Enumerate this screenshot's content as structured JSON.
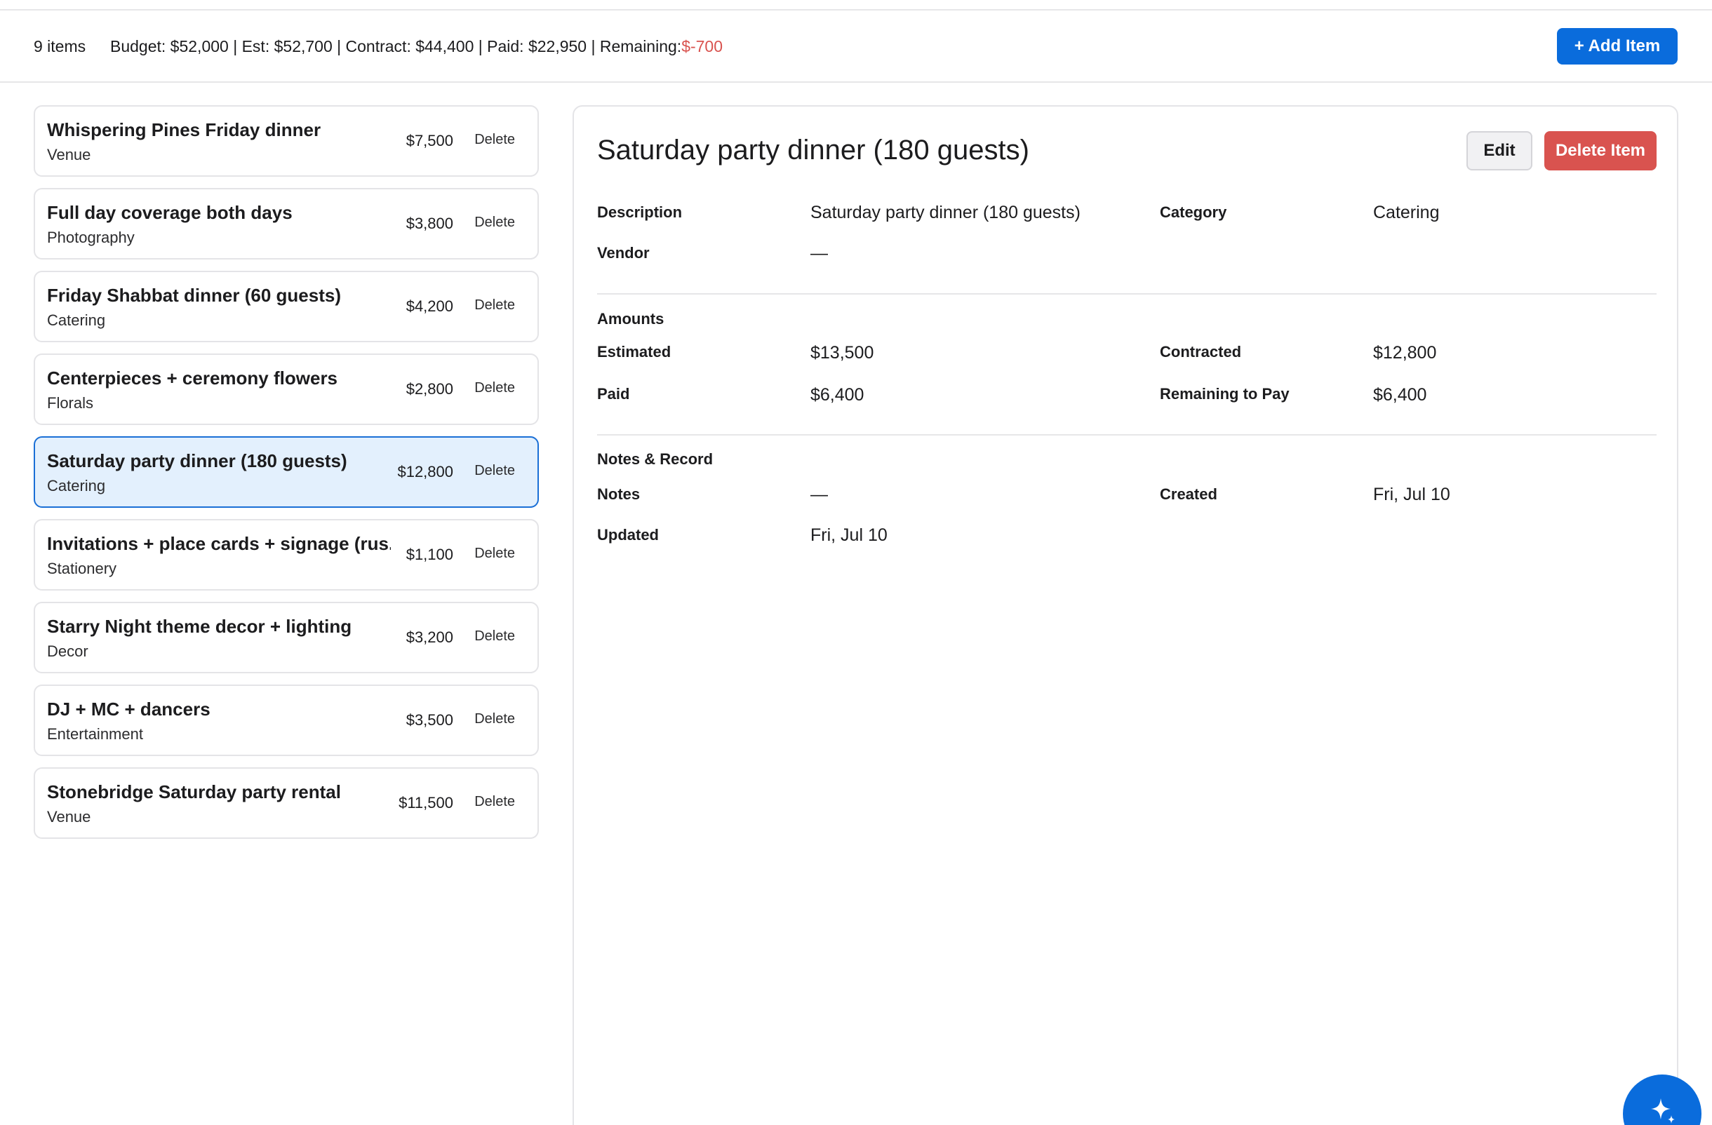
{
  "header": {
    "item_count": "9 items",
    "budget": "Budget: $52,000",
    "est": "Est: $52,700",
    "contract": "Contract: $44,400",
    "paid": "Paid: $22,950",
    "remaining_label": "Remaining:",
    "remaining_value": "$-700",
    "separator": "|",
    "add_button": "+ Add Item"
  },
  "items": [
    {
      "title": "Whispering Pines Friday dinner",
      "category": "Venue",
      "amount": "$7,500",
      "delete": "Delete"
    },
    {
      "title": "Full day coverage both days",
      "category": "Photography",
      "amount": "$3,800",
      "delete": "Delete"
    },
    {
      "title": "Friday Shabbat dinner (60 guests)",
      "category": "Catering",
      "amount": "$4,200",
      "delete": "Delete"
    },
    {
      "title": "Centerpieces + ceremony flowers",
      "category": "Florals",
      "amount": "$2,800",
      "delete": "Delete"
    },
    {
      "title": "Saturday party dinner (180 guests)",
      "category": "Catering",
      "amount": "$12,800",
      "delete": "Delete"
    },
    {
      "title": "Invitations + place cards + signage (rus...",
      "category": "Stationery",
      "amount": "$1,100",
      "delete": "Delete"
    },
    {
      "title": "Starry Night theme decor + lighting",
      "category": "Decor",
      "amount": "$3,200",
      "delete": "Delete"
    },
    {
      "title": "DJ + MC + dancers",
      "category": "Entertainment",
      "amount": "$3,500",
      "delete": "Delete"
    },
    {
      "title": "Stonebridge Saturday party rental",
      "category": "Venue",
      "amount": "$11,500",
      "delete": "Delete"
    }
  ],
  "selected_index": 4,
  "detail": {
    "title": "Saturday party dinner (180 guests)",
    "edit_button": "Edit",
    "delete_button": "Delete Item",
    "description_label": "Description",
    "description_value": "Saturday party dinner (180 guests)",
    "category_label": "Category",
    "category_value": "Catering",
    "vendor_label": "Vendor",
    "vendor_value": "—",
    "amounts_heading": "Amounts",
    "estimated_label": "Estimated",
    "estimated_value": "$13,500",
    "contracted_label": "Contracted",
    "contracted_value": "$12,800",
    "paid_label": "Paid",
    "paid_value": "$6,400",
    "remaining_label": "Remaining to Pay",
    "remaining_value": "$6,400",
    "notes_heading": "Notes & Record",
    "notes_label": "Notes",
    "notes_value": "—",
    "created_label": "Created",
    "created_value": "Fri, Jul 10",
    "updated_label": "Updated",
    "updated_value": "Fri, Jul 10"
  },
  "colors": {
    "accent": "#0a6cdc",
    "danger": "#d9534f",
    "selected_bg": "#e3f0fd"
  },
  "fab_icon": "sparkle-icon"
}
